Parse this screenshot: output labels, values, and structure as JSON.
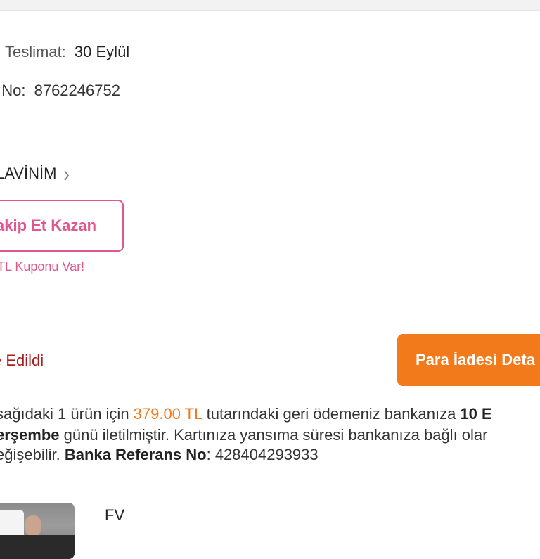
{
  "delivery": {
    "label": "Teslimat:",
    "value": "30 Eylül"
  },
  "order": {
    "label": "t No:",
    "value": "8762246752"
  },
  "seller": {
    "label": "LAVİNİM"
  },
  "follow": {
    "button_label": "akip Et Kazan",
    "coupon_text": "TL Kuponu Var!"
  },
  "refund": {
    "status": "e Edildi",
    "details_button": "Para İadesi Deta",
    "line1_prefix": "sağıdaki 1 ürün için ",
    "amount": "379.00 TL",
    "line1_suffix": " tutarındaki geri ödemeniz bankanıza ",
    "line1_bold": "10 E",
    "line2_bold": "erşembe",
    "line2_text": " günü iletilmiştir. Kartınıza yansıma süresi bankanıza bağlı olar",
    "line3_text": "eğişebilir. ",
    "ref_label": "Banka Referans No",
    "ref_value": ": 428404293933"
  },
  "product": {
    "brand": "FV"
  }
}
